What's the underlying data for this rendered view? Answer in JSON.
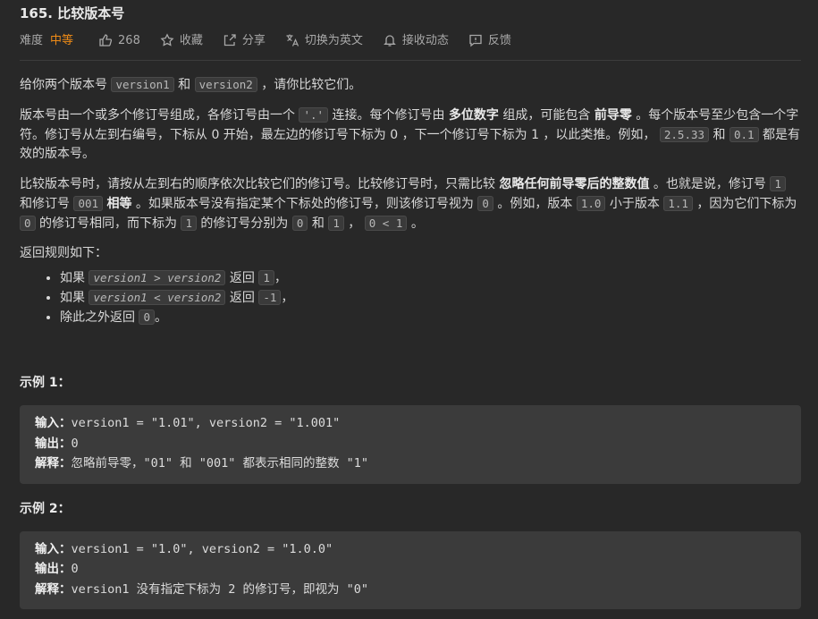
{
  "header": {
    "title": "165. 比较版本号",
    "difficulty_label": "难度",
    "difficulty_value": "中等",
    "likes": "268",
    "favorite": "收藏",
    "share": "分享",
    "switch_lang": "切换为英文",
    "notify": "接收动态",
    "feedback": "反馈",
    "accent_color": "#ef8b17"
  },
  "intro": {
    "t1": "给你两个版本号 ",
    "c1": "version1",
    "t2": " 和 ",
    "c2": "version2",
    "t3": " ，请你比较它们。"
  },
  "para2": {
    "t1": "版本号由一个或多个修订号组成，各修订号由一个 ",
    "c1": "'.'",
    "t2": " 连接。每个修订号由 ",
    "b1": "多位数字",
    "t3": " 组成，可能包含 ",
    "b2": "前导零",
    "t4": " 。每个版本号至少包含一个字符。修订号从左到右编号，下标从 0 开始，最左边的修订号下标为 0 ，下一个修订号下标为 1 ，以此类推。例如， ",
    "c2": "2.5.33",
    "t5": " 和 ",
    "c3": "0.1",
    "t6": " 都是有效的版本号。"
  },
  "para3": {
    "t1": "比较版本号时，请按从左到右的顺序依次比较它们的修订号。比较修订号时，只需比较 ",
    "b1": "忽略任何前导零后的整数值",
    "t2": " 。也就是说，修订号 ",
    "c1": "1",
    "t3": " 和修订号 ",
    "c2": "001",
    "t4": " ",
    "b2": "相等",
    "t5": " 。如果版本号没有指定某个下标处的修订号，则该修订号视为 ",
    "c3": "0",
    "t6": " 。例如，版本 ",
    "c4": "1.0",
    "t7": " 小于版本 ",
    "c5": "1.1",
    "t8": " ，因为它们下标为 ",
    "c6": "0",
    "t9": " 的修订号相同，而下标为 ",
    "c7": "1",
    "t10": " 的修订号分别为 ",
    "c8": "0",
    "t11": " 和 ",
    "c9": "1",
    "t12": " ， ",
    "c10": "0 < 1",
    "t13": " 。"
  },
  "rules": {
    "heading": "返回规则如下：",
    "items": [
      {
        "pre": "如果 ",
        "expr": "version1 > version2",
        "mid": " 返回 ",
        "ret": "1",
        "post": "，"
      },
      {
        "pre": "如果 ",
        "expr": "version1 < version2",
        "mid": " 返回 ",
        "ret": "-1",
        "post": "，"
      },
      {
        "pre": "除此之外返回 ",
        "ret": "0",
        "post": "。"
      }
    ]
  },
  "examples": [
    {
      "title": "示例 1：",
      "input_label": "输入：",
      "input": "version1 = \"1.01\", version2 = \"1.001\"",
      "output_label": "输出：",
      "output": "0",
      "explain_label": "解释：",
      "explain": "忽略前导零，\"01\" 和 \"001\" 都表示相同的整数 \"1\""
    },
    {
      "title": "示例 2：",
      "input_label": "输入：",
      "input": "version1 = \"1.0\", version2 = \"1.0.0\"",
      "output_label": "输出：",
      "output": "0",
      "explain_label": "解释：",
      "explain": "version1 没有指定下标为 2 的修订号，即视为 \"0\""
    }
  ]
}
